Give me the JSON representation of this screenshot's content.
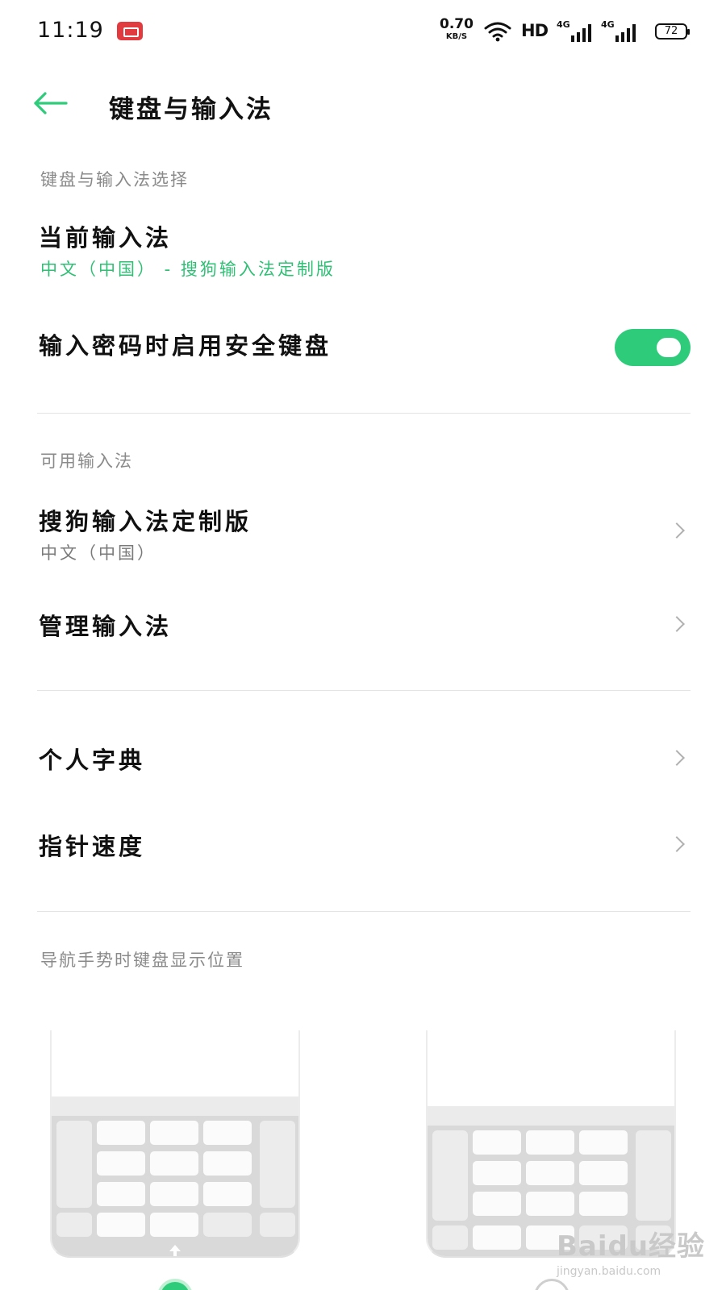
{
  "status_bar": {
    "time": "11:19",
    "net_speed_value": "0.70",
    "net_speed_unit": "KB/S",
    "hd": "HD",
    "sim1_tag": "4G",
    "sim2_tag": "4G",
    "battery": "72"
  },
  "header": {
    "title": "键盘与输入法"
  },
  "section_input_select": {
    "label": "键盘与输入法选择",
    "current_ime_title": "当前输入法",
    "current_ime_value": "中文（中国） - 搜狗输入法定制版",
    "secure_keyboard_title": "输入密码时启用安全键盘",
    "secure_keyboard_enabled": true
  },
  "section_available": {
    "label": "可用输入法",
    "ime_name": "搜狗输入法定制版",
    "ime_lang": "中文（中国）",
    "manage_label": "管理输入法"
  },
  "section_misc": {
    "dictionary_label": "个人字典",
    "pointer_speed_label": "指针速度"
  },
  "section_gesture": {
    "label": "导航手势时键盘显示位置",
    "selected_option": 1
  },
  "watermark": {
    "brand": "Baidu经验",
    "site": "jingyan.baidu.com"
  },
  "colors": {
    "accent": "#2ecc7a",
    "accent_text": "#2fbf75",
    "secondary_text": "#8a8a8a",
    "divider": "#e4e4e4"
  }
}
